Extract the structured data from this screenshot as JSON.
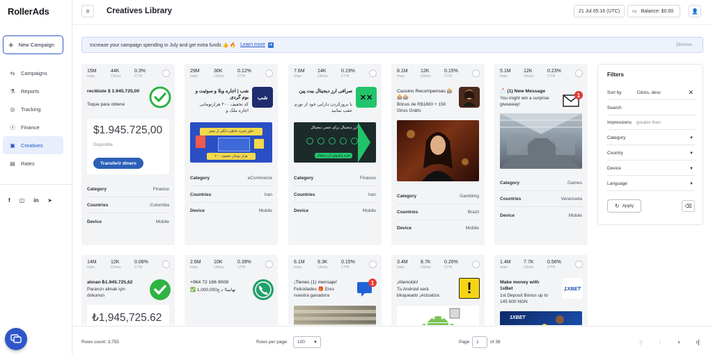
{
  "brand": {
    "logo": "RollerAds"
  },
  "sidebar": {
    "new_campaign": "New Campaign",
    "items": [
      {
        "label": "Campaigns",
        "icon": "campaigns-icon"
      },
      {
        "label": "Reports",
        "icon": "reports-icon"
      },
      {
        "label": "Tracking",
        "icon": "tracking-icon"
      },
      {
        "label": "Finance",
        "icon": "finance-icon"
      },
      {
        "label": "Creatives",
        "icon": "creatives-icon",
        "active": true
      },
      {
        "label": "Rates",
        "icon": "rates-icon"
      }
    ],
    "socials": [
      "facebook-icon",
      "instagram-icon",
      "linkedin-icon",
      "telegram-icon"
    ]
  },
  "header": {
    "title": "Creatives Library",
    "datetime": "21 Jul 05:16 (UTC)",
    "balance": "Balance: $0.00"
  },
  "banner": {
    "text": "Increase your campaign spending in July and get extra funds 👍 🔥",
    "link": "Learn more",
    "dismiss": "Dismiss"
  },
  "metric_labels": {
    "impr": "Impr.",
    "clicks": "Clicks",
    "ctr": "CTR"
  },
  "row_labels": {
    "category": "Category",
    "countries": "Countries",
    "device": "Device"
  },
  "cards": [
    {
      "impr": "15M",
      "clicks": "44K",
      "ctr": "0.3%",
      "title": "recibiste $ 1.945.725,00",
      "body": "Toque para obtene",
      "promo_amount": "$1.945.725,00",
      "promo_sub": "Disponible",
      "promo_btn": "Transferir dinero",
      "category": "Finance",
      "countries": "Colombia",
      "device": "Mobile"
    },
    {
      "impr": "29M",
      "clicks": "36K",
      "ctr": "0.12%",
      "title": "شب | اجاره ویلا و سوئیت و بوم گردی",
      "body": "کد تخفیف ۲۰۰ هزارتومانی اجاره ملک و",
      "thumb_text": "شب",
      "img_text_1": "خلق تجربه خاطره انگیز از سفر",
      "img_text_2": "۲۰۰ هزار تومان تخفیف",
      "category": "eCommerce",
      "countries": "Iran",
      "device": "Mobile"
    },
    {
      "impr": "7.6M",
      "clicks": "14K",
      "ctr": "0.19%",
      "title": "صرافی ارز دیجیتال بیت پین",
      "body": "با بروزکردن دارایی خود از تورم عقب نمانید",
      "img_text_1": "ارز دیجیتال برای عصر دیجیتال",
      "img_text_2": "خرید و فروش ارز دیجیتال",
      "category": "Finance",
      "countries": "Iran",
      "device": "Mobile"
    },
    {
      "impr": "8.1M",
      "clicks": "12K",
      "ctr": "0.15%",
      "title": "Cassino Recompensas 🎰🎰🎰",
      "body": "Bônus de R$1800 + 150 Giros Grátis",
      "category": "Gambling",
      "countries": "Brazil",
      "device": "Mobile"
    },
    {
      "impr": "5.1M",
      "clicks": "12K",
      "ctr": "0.23%",
      "title": "📩 (1) New Message",
      "body": "You might win a surprise giveaway!",
      "badge": "1",
      "category": "Games",
      "countries": "Venezuela",
      "device": "Mobile"
    },
    {
      "impr": "14M",
      "clicks": "12K",
      "ctr": "0.08%",
      "title": "alınan ₺1.945.725,62",
      "body": "Paranızı almak için dokunun",
      "promo_amount": "₺1,945,725.62"
    },
    {
      "impr": "2.6M",
      "clicks": "10K",
      "ctr": "0.39%",
      "title": "+964 72 166 9008",
      "body": "✅ تهانينا! د.ع1,000,000"
    },
    {
      "impr": "6.1M",
      "clicks": "9.3K",
      "ctr": "0.15%",
      "title": "¡Tienes (1) mensaje!",
      "body": "Felicidades 🎁 Eres nuestra ganadora",
      "badge": "1"
    },
    {
      "impr": "3.4M",
      "clicks": "8.7K",
      "ctr": "0.26%",
      "title": "¡Atención!",
      "body": "Tu Android será bloqueado ¡Actualiza"
    },
    {
      "impr": "1.4M",
      "clicks": "7.7K",
      "ctr": "0.56%",
      "title": "Make money with 1xBet",
      "body": "1st Deposit Bonus up to 145 600 NGN",
      "thumb_text": "1XBET",
      "img_text": "1XBET"
    }
  ],
  "filters": {
    "title": "Filters",
    "sort_label": "Sort by",
    "sort_value": "Clicks, desc",
    "search": "Search",
    "impressions": "Impressions",
    "impressions_placeholder": "greater than",
    "category": "Category",
    "country": "Country",
    "device": "Device",
    "language": "Language",
    "apply": "Apply"
  },
  "footer": {
    "rows_count": "Rows count: 3,755",
    "rows_per_page_label": "Rows per page:",
    "rows_per_page": "100",
    "page_label": "Page",
    "page": "1",
    "of_pages": "of 38"
  },
  "colors": {
    "accent": "#2f56c9",
    "card_bg": "#f3f4f6",
    "green": "#2fb344"
  }
}
